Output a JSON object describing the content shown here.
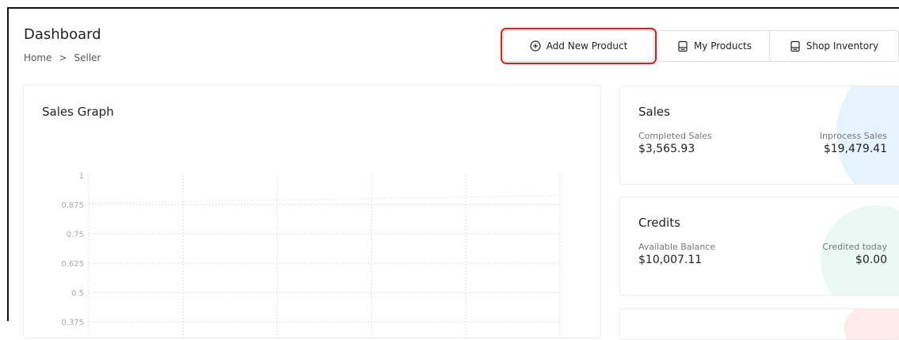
{
  "header": {
    "title": "Dashboard",
    "breadcrumb": [
      "Home",
      ">",
      "Seller"
    ]
  },
  "toolbar": {
    "add_product_label": "Add New Product",
    "my_products_label": "My Products",
    "shop_inventory_label": "Shop Inventory"
  },
  "graph": {
    "title": "Sales Graph"
  },
  "chart_data": {
    "type": "line",
    "title": "Sales Graph",
    "y_ticks": [
      "1",
      "0.875",
      "0.75",
      "0.625",
      "0.5",
      "0.375"
    ],
    "ylim": [
      0.375,
      1
    ],
    "grid": true
  },
  "sales": {
    "title": "Sales",
    "completed_label": "Completed Sales",
    "completed_value": "$3,565.93",
    "inprocess_label": "Inprocess Sales",
    "inprocess_value": "$19,479.41"
  },
  "credits": {
    "title": "Credits",
    "available_label": "Available Balance",
    "available_value": "$10,007.11",
    "credited_label": "Credited today",
    "credited_value": "$0.00"
  },
  "colors": {
    "highlight": "#e01b1b",
    "sales_blob": "#cfe9ff",
    "credits_blob": "#d9f5ea",
    "third_blob": "#ffd8d8"
  }
}
